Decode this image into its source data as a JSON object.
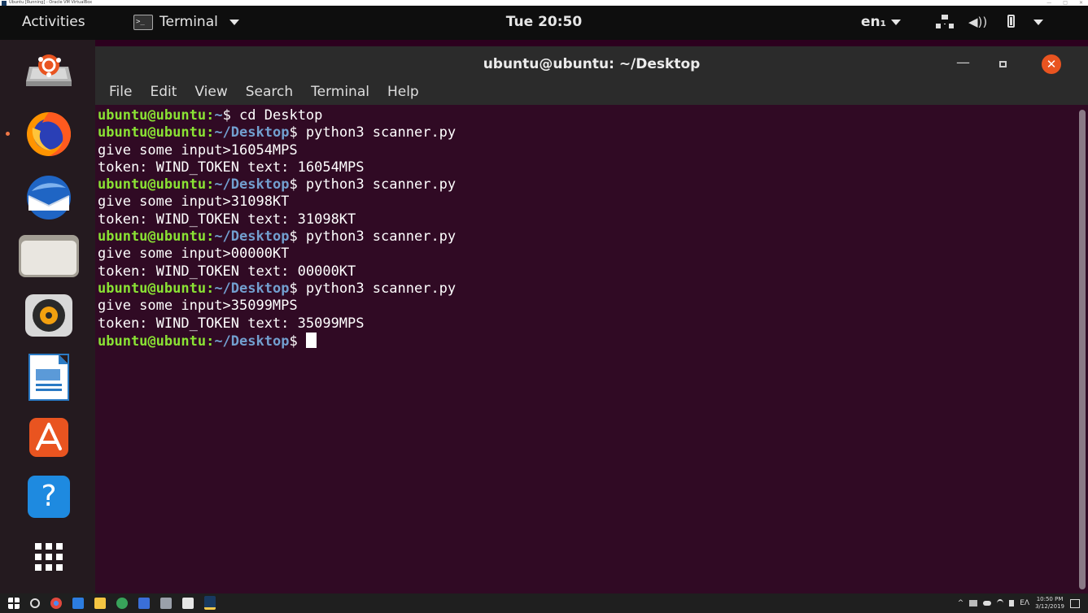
{
  "vbox": {
    "title": "Ubuntu [Running] - Oracle VM VirtualBox",
    "minimize_glyph": "—",
    "restore_glyph": "□",
    "close_glyph": "✕"
  },
  "topbar": {
    "activities": "Activities",
    "app_name": "Terminal",
    "terminal_icon_glyph": ">_",
    "clock": "Tue 20:50",
    "language": "en₁",
    "volume_glyph": "◀))"
  },
  "terminal": {
    "window_title": "ubuntu@ubuntu: ~/Desktop",
    "minimize_glyph": "—",
    "close_glyph": "✕",
    "menu": [
      "File",
      "Edit",
      "View",
      "Search",
      "Terminal",
      "Help"
    ],
    "prompt_user": "ubuntu@ubuntu",
    "prompt_sep": ":",
    "lines": [
      {
        "path": "~",
        "cmd": " cd Desktop"
      },
      {
        "path": "~/Desktop",
        "cmd": " python3 scanner.py"
      },
      {
        "out": "give some input>16054MPS"
      },
      {
        "out": "token: WIND_TOKEN text: 16054MPS"
      },
      {
        "path": "~/Desktop",
        "cmd": " python3 scanner.py"
      },
      {
        "out": "give some input>31098KT"
      },
      {
        "out": "token: WIND_TOKEN text: 31098KT"
      },
      {
        "path": "~/Desktop",
        "cmd": " python3 scanner.py"
      },
      {
        "out": "give some input>00000KT"
      },
      {
        "out": "token: WIND_TOKEN text: 00000KT"
      },
      {
        "path": "~/Desktop",
        "cmd": " python3 scanner.py"
      },
      {
        "out": "give some input>35099MPS"
      },
      {
        "out": "token: WIND_TOKEN text: 35099MPS"
      },
      {
        "path": "~/Desktop",
        "cmd": " ",
        "cursor": true
      }
    ]
  },
  "dock": {
    "help_glyph": "?",
    "items": [
      "install-icon",
      "firefox-icon",
      "thunderbird-icon",
      "files-icon",
      "rhythmbox-icon",
      "writer-icon",
      "software-icon",
      "help-icon",
      "show-apps-icon"
    ]
  },
  "taskbar": {
    "tray_lang": "ΕΛ",
    "time": "10:50 PM",
    "date": "3/12/2019",
    "tray_glyphs": "^"
  },
  "colors": {
    "terminal_bg": "#300a24",
    "prompt_user": "#8ae234",
    "prompt_path": "#729fcf",
    "accent": "#e95420"
  }
}
